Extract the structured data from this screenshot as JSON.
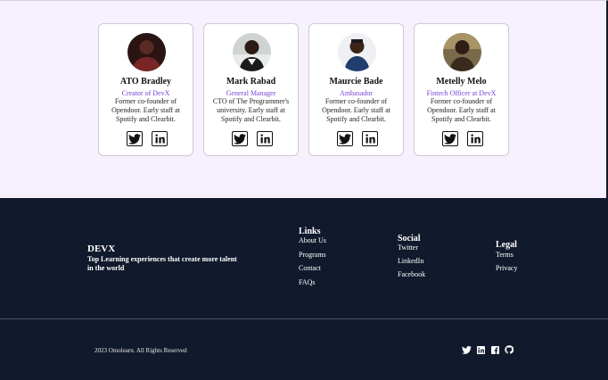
{
  "team": {
    "members": [
      {
        "name": "ATO Bradley",
        "role": "Creator of DevX",
        "bio": "Former co-founder of Opendoor. Early staff at Spotify and Clearbit.",
        "avatar": "avatar-photo"
      },
      {
        "name": "Mark Rabad",
        "role": "General Manager",
        "bio": "CTO of The Programmer's university. Early staff at Spotify and Clearbit.",
        "avatar": "avatar-photo"
      },
      {
        "name": "Maurcie Bade",
        "role": "Ambasador",
        "bio": "Former co-founder of Opendoor. Early staff at Spotify and Clearbit.",
        "avatar": "avatar-photo"
      },
      {
        "name": "Metelly Melo",
        "role": "Fintech Officer at DevX",
        "bio": "Former co-founder of Opendoor. Early staff at Spotify and Clearbit.",
        "avatar": "avatar-photo"
      }
    ],
    "social_icons": [
      "twitter-icon",
      "linkedin-icon"
    ]
  },
  "footer": {
    "brand": "DEVX",
    "tagline": "Top Learning experiences that create more talent in the world",
    "columns": [
      {
        "title": "Links",
        "items": [
          "About Us",
          "Programs",
          "Contact",
          "FAQs"
        ]
      },
      {
        "title": "Social",
        "items": [
          "Twitter",
          "LinkedIn",
          "Facebook"
        ]
      },
      {
        "title": "Legal",
        "items": [
          "Terms",
          "Privacy"
        ]
      }
    ],
    "copyright": "2023 Omolearn. All Rights Reserved",
    "icons": [
      "twitter-icon",
      "linkedin-icon",
      "facebook-icon",
      "github-icon"
    ]
  },
  "colors": {
    "page_bg": "#f7f0fd",
    "footer_bg": "#111a2c",
    "role_accent": "#7a43d8"
  }
}
